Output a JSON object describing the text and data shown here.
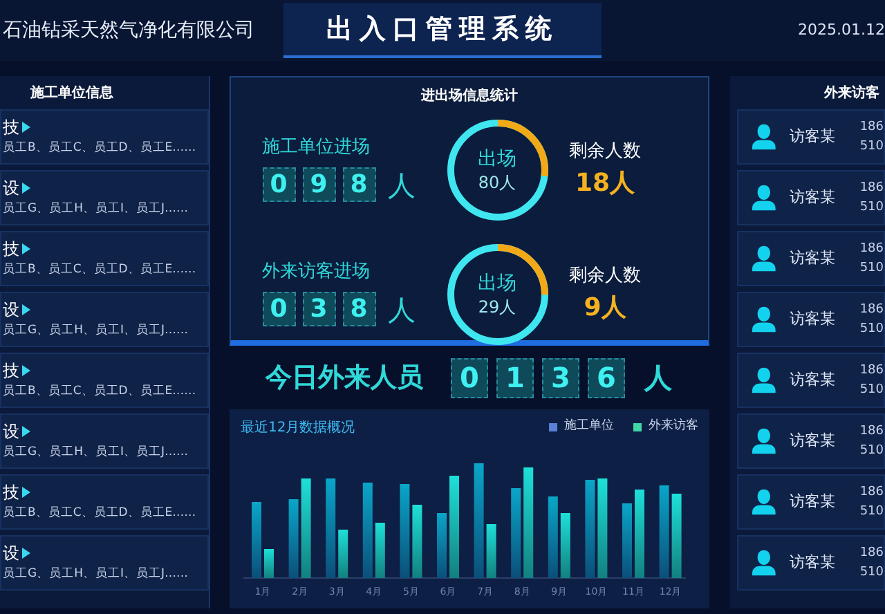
{
  "header": {
    "company": "石油钻采天然气净化有限公司",
    "title": "出入口管理系统",
    "date": "2025.01.12"
  },
  "contractors": {
    "title": "施工单位信息",
    "rows": [
      {
        "name": "技",
        "staff": "员工B、员工C、员工D、员工E……"
      },
      {
        "name": "设",
        "staff": "员工G、员工H、员工I、员工J……"
      },
      {
        "name": "技",
        "staff": "员工B、员工C、员工D、员工E……"
      },
      {
        "name": "设",
        "staff": "员工G、员工H、员工I、员工J……"
      },
      {
        "name": "技",
        "staff": "员工B、员工C、员工D、员工E……"
      },
      {
        "name": "设",
        "staff": "员工G、员工H、员工I、员工J……"
      },
      {
        "name": "技",
        "staff": "员工B、员工C、员工D、员工E……"
      },
      {
        "name": "设",
        "staff": "员工G、员工H、员工I、员工J……"
      }
    ]
  },
  "stats": {
    "title": "进出场信息统计",
    "groups": [
      {
        "label": "施工单位进场",
        "digits": [
          "0",
          "9",
          "8"
        ],
        "unit": "人",
        "ring_title": "出场",
        "ring_value": "80人",
        "level": 0.27,
        "remain_label": "剩余人数",
        "remain_value": "18人"
      },
      {
        "label": "外来访客进场",
        "digits": [
          "0",
          "3",
          "8"
        ],
        "unit": "人",
        "ring_title": "出场",
        "ring_value": "29人",
        "level": 0.25,
        "remain_label": "剩余人数",
        "remain_value": "9人"
      }
    ]
  },
  "today": {
    "label": "今日外来人员",
    "digits": [
      "0",
      "1",
      "3",
      "6"
    ],
    "unit": "人"
  },
  "chart": {
    "title": "最近12月数据概况",
    "legend": [
      {
        "label": "施工单位",
        "color": "#5a80d8"
      },
      {
        "label": "外来访客",
        "color": "#41d6a6"
      }
    ],
    "months": [
      "1月",
      "2月",
      "3月",
      "4月",
      "5月",
      "6月",
      "7月",
      "8月",
      "9月",
      "10月",
      "11月",
      "12月"
    ]
  },
  "visitors": {
    "title": "外来访客",
    "rows": [
      {
        "name": "访客某",
        "phone": "186",
        "id": "510"
      },
      {
        "name": "访客某",
        "phone": "186",
        "id": "510"
      },
      {
        "name": "访客某",
        "phone": "186",
        "id": "510"
      },
      {
        "name": "访客某",
        "phone": "186",
        "id": "510"
      },
      {
        "name": "访客某",
        "phone": "186",
        "id": "510"
      },
      {
        "name": "访客某",
        "phone": "186",
        "id": "510"
      },
      {
        "name": "访客某",
        "phone": "186",
        "id": "510"
      },
      {
        "name": "访客某",
        "phone": "186",
        "id": "510"
      }
    ]
  }
}
